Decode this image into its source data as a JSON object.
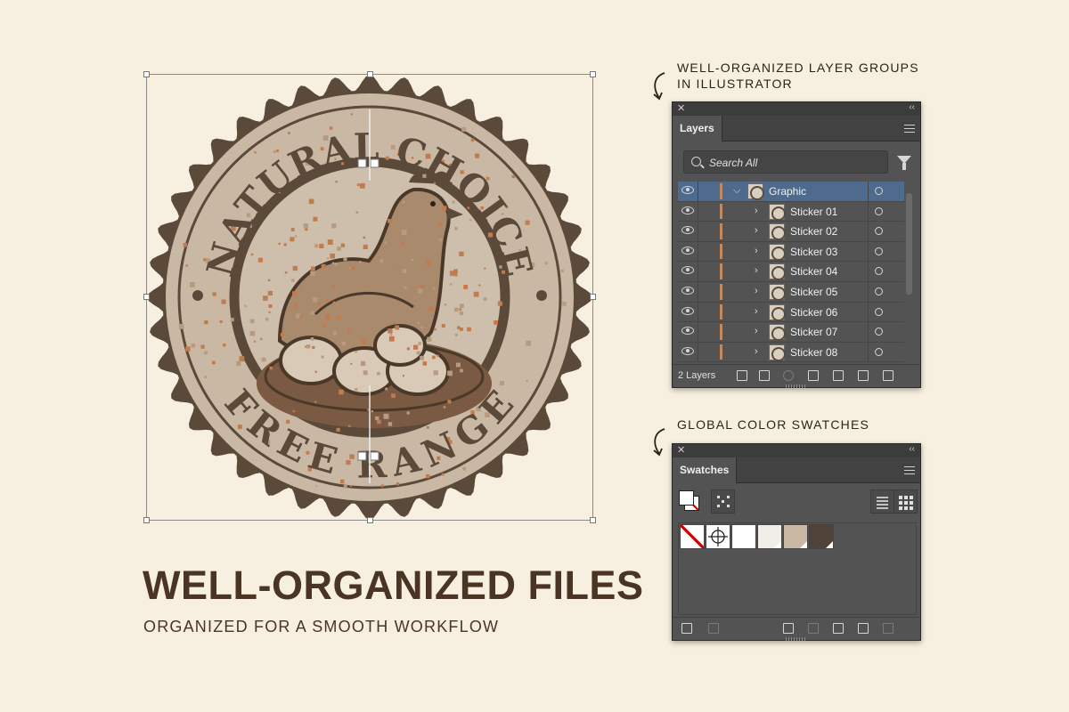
{
  "colors": {
    "background": "#f7efe0",
    "badge_dark": "#5b4a3a",
    "badge_light": "#c9b9a4",
    "accent_copper": "#c27b4d",
    "title_brown": "#4a3525"
  },
  "badge": {
    "top_text": "NATURAL CHOICE",
    "bottom_text": "FREE RANGE"
  },
  "headline": {
    "title": "WELL-ORGANIZED FILES",
    "subtitle": "ORGANIZED FOR A SMOOTH WORKFLOW"
  },
  "annotations": {
    "layers_line1": "WELL-ORGANIZED LAYER GROUPS",
    "layers_line2": "IN ILLUSTRATOR",
    "swatches": "GLOBAL COLOR SWATCHES"
  },
  "layers_panel": {
    "close_glyph": "✕",
    "collapse_glyph": "‹‹",
    "tab": "Layers",
    "search_placeholder": "Search All",
    "rows": [
      {
        "name": "Graphic",
        "chevron": "⌵"
      },
      {
        "name": "Sticker 01",
        "chevron": "›"
      },
      {
        "name": "Sticker 02",
        "chevron": "›"
      },
      {
        "name": "Sticker 03",
        "chevron": "›"
      },
      {
        "name": "Sticker 04",
        "chevron": "›"
      },
      {
        "name": "Sticker 05",
        "chevron": "›"
      },
      {
        "name": "Sticker 06",
        "chevron": "›"
      },
      {
        "name": "Sticker 07",
        "chevron": "›"
      },
      {
        "name": "Sticker 08",
        "chevron": "›"
      }
    ],
    "footer_count": "2 Layers",
    "footer_icons": [
      "collect-export-icon",
      "export-icon",
      "locate-object-icon",
      "clipping-mask-icon",
      "new-sublayer-icon",
      "new-layer-icon",
      "trash-icon"
    ]
  },
  "swatches_panel": {
    "close_glyph": "✕",
    "collapse_glyph": "‹‹",
    "tab": "Swatches",
    "swatch_items": [
      {
        "kind": "none"
      },
      {
        "kind": "registration"
      },
      {
        "kind": "color",
        "hex": "#ffffff"
      },
      {
        "kind": "color",
        "hex": "#f1eee9"
      },
      {
        "kind": "color",
        "hex": "#c9b9a4"
      },
      {
        "kind": "color",
        "hex": "#4f4339"
      }
    ],
    "footer_icons": [
      "swatch-libraries-icon",
      "place-swatches-icon",
      "show-kinds-icon",
      "swatch-options-icon",
      "new-group-icon",
      "new-swatch-icon",
      "trash-icon"
    ]
  }
}
